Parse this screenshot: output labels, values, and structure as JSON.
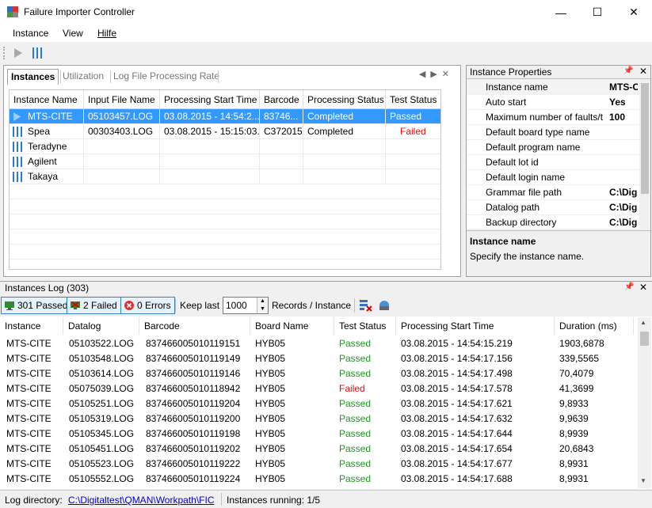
{
  "window": {
    "title": "Failure Importer Controller",
    "min_glyph": "—",
    "max_glyph": "☐",
    "close_glyph": "✕"
  },
  "menu": [
    "Instance",
    "View",
    "Hilfe"
  ],
  "toolbar": {
    "play_icon": "play-icon",
    "bars_icon": "instance-bars-icon"
  },
  "instances_panel": {
    "tabs": [
      "Instances",
      "Utilization",
      "Log File Processing Rate"
    ],
    "controls": "◀▶✕",
    "columns": [
      "Instance Name",
      "Input File Name",
      "Processing Start Time",
      "Barcode",
      "Processing Status",
      "Test Status"
    ],
    "rows": [
      {
        "name": "MTS-CITE",
        "file": "05103457.LOG",
        "start": "03.08.2015 - 14:54:2...",
        "barcode": "83746...",
        "proc": "Completed",
        "test": "Passed",
        "status": "passed"
      },
      {
        "name": "Spea",
        "file": "00303403.LOG",
        "start": "03.08.2015 - 15:15:03.",
        "barcode": "C372015",
        "proc": "Completed",
        "test": "Failed",
        "status": "failed"
      },
      {
        "name": "Teradyne",
        "file": "",
        "start": "",
        "barcode": "",
        "proc": "",
        "test": "",
        "status": ""
      },
      {
        "name": "Agilent",
        "file": "",
        "start": "",
        "barcode": "",
        "proc": "",
        "test": "",
        "status": ""
      },
      {
        "name": "Takaya",
        "file": "",
        "start": "",
        "barcode": "",
        "proc": "",
        "test": "",
        "status": ""
      }
    ]
  },
  "properties_panel": {
    "title": "Instance Properties",
    "pin_glyph": "📌",
    "close_glyph": "✕",
    "rows": [
      {
        "name": "Instance name",
        "value": "MTS-C"
      },
      {
        "name": "Auto start",
        "value": "Yes"
      },
      {
        "name": "Maximum number of faults/t",
        "value": "100"
      },
      {
        "name": "Default board type name",
        "value": ""
      },
      {
        "name": "Default program name",
        "value": ""
      },
      {
        "name": "Default lot id",
        "value": ""
      },
      {
        "name": "Default login name",
        "value": ""
      },
      {
        "name": "Grammar file path",
        "value": "C:\\Dig"
      },
      {
        "name": "Datalog path",
        "value": "C:\\Dig"
      },
      {
        "name": "Backup directory",
        "value": "C:\\Dig"
      }
    ],
    "desc_title": "Instance name",
    "desc_text": "Specify the instance name."
  },
  "log_panel": {
    "title": "Instances Log (303)",
    "passed_label": "301 Passed",
    "failed_label": "2 Failed",
    "errors_label": "0 Errors",
    "keep_last_label": "Keep last",
    "keep_last_value": "1000",
    "records_label": "Records / Instance",
    "columns": [
      "Instance",
      "Datalog",
      "Barcode",
      "Board Name",
      "Test Status",
      "Processing Start Time",
      "Duration (ms)"
    ],
    "rows": [
      [
        "MTS-CITE",
        "05103522.LOG",
        "837466005010119151",
        "HYB05",
        "Passed",
        "03.08.2015 - 14:54:15.219",
        "1903,6878"
      ],
      [
        "MTS-CITE",
        "05103548.LOG",
        "837466005010119149",
        "HYB05",
        "Passed",
        "03.08.2015 - 14:54:17.156",
        "339,5565"
      ],
      [
        "MTS-CITE",
        "05103614.LOG",
        "837466005010119146",
        "HYB05",
        "Passed",
        "03.08.2015 - 14:54:17.498",
        "70,4079"
      ],
      [
        "MTS-CITE",
        "05075039.LOG",
        "837466005010118942",
        "HYB05",
        "Failed",
        "03.08.2015 - 14:54:17.578",
        "41,3699"
      ],
      [
        "MTS-CITE",
        "05105251.LOG",
        "837466005010119204",
        "HYB05",
        "Passed",
        "03.08.2015 - 14:54:17.621",
        "9,8933"
      ],
      [
        "MTS-CITE",
        "05105319.LOG",
        "837466005010119200",
        "HYB05",
        "Passed",
        "03.08.2015 - 14:54:17.632",
        "9,9639"
      ],
      [
        "MTS-CITE",
        "05105345.LOG",
        "837466005010119198",
        "HYB05",
        "Passed",
        "03.08.2015 - 14:54:17.644",
        "8,9939"
      ],
      [
        "MTS-CITE",
        "05105451.LOG",
        "837466005010119202",
        "HYB05",
        "Passed",
        "03.08.2015 - 14:54:17.654",
        "20,6843"
      ],
      [
        "MTS-CITE",
        "05105523.LOG",
        "837466005010119222",
        "HYB05",
        "Passed",
        "03.08.2015 - 14:54:17.677",
        "8,9931"
      ],
      [
        "MTS-CITE",
        "05105552.LOG",
        "837466005010119224",
        "HYB05",
        "Passed",
        "03.08.2015 - 14:54:17.688",
        "8,9931"
      ]
    ]
  },
  "statusbar": {
    "log_dir_label": "Log directory:",
    "log_dir_value": "C:\\Digitaltest\\QMAN\\Workpath\\FIC",
    "running": "Instances running: 1/5"
  },
  "colors": {
    "selection": "#3399ff",
    "passed": "#1a9a1a",
    "failed": "#e01010",
    "accent_blue": "#3c7fb1"
  }
}
